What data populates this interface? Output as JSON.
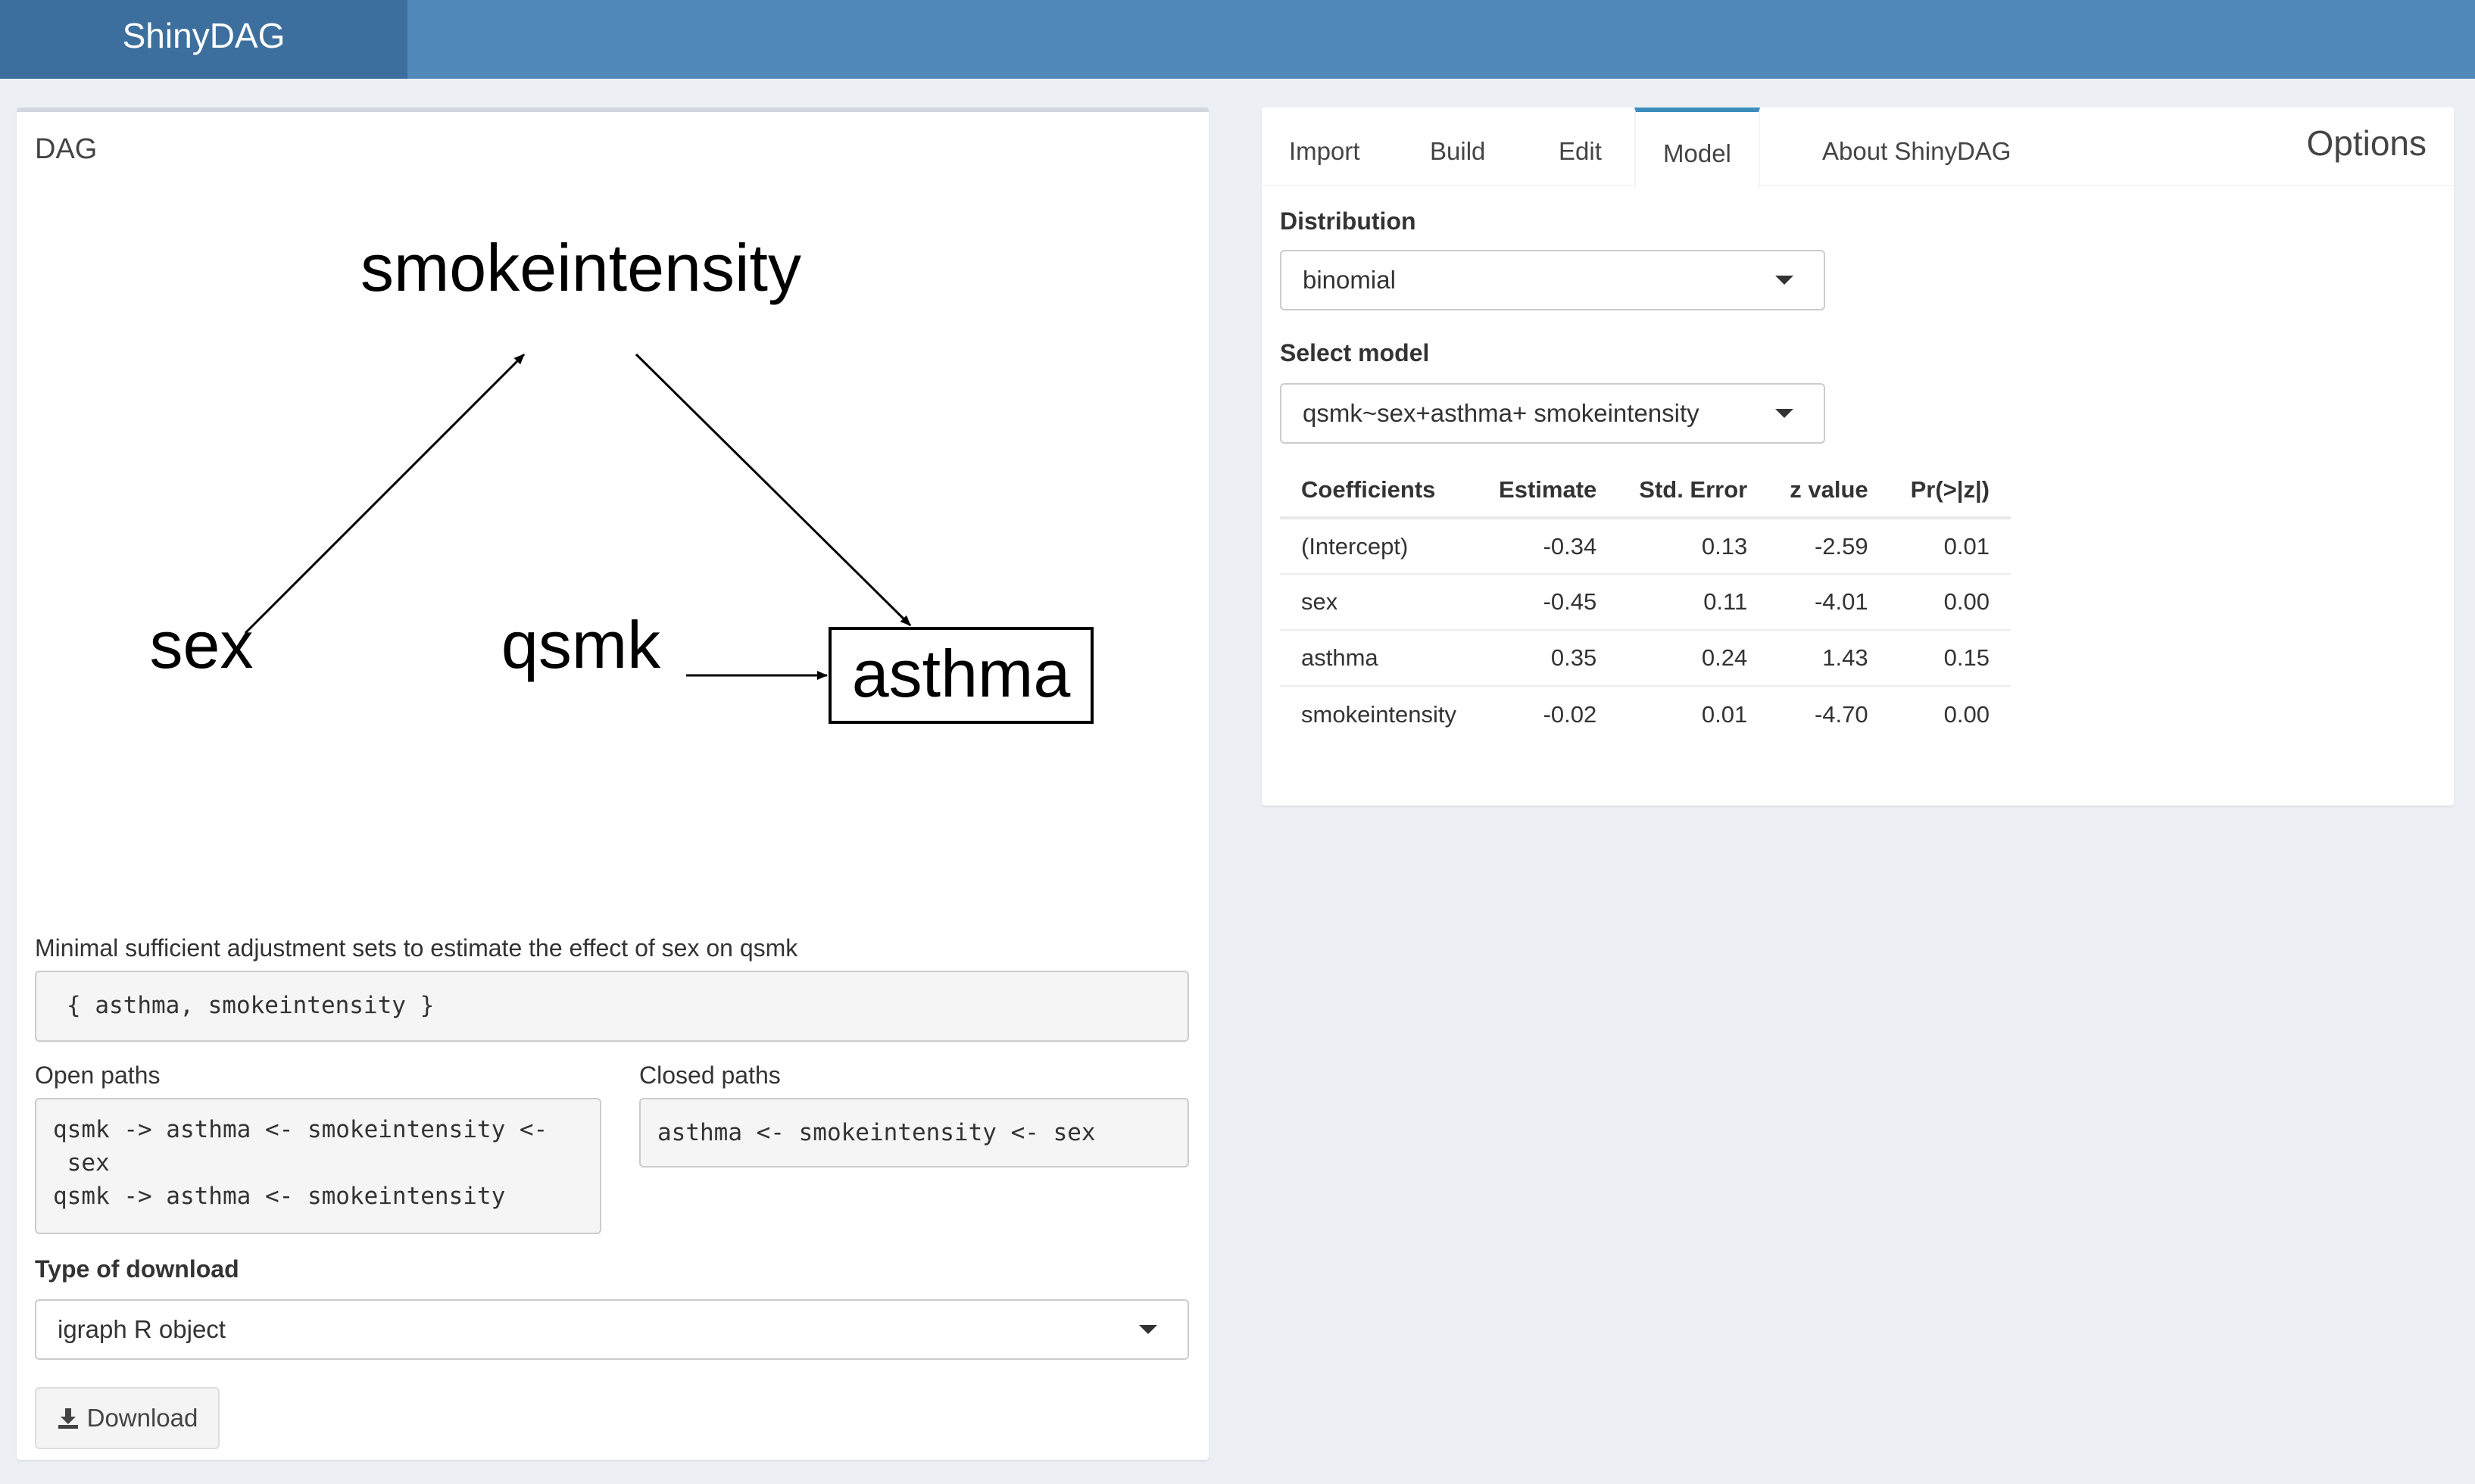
{
  "app": {
    "title": "ShinyDAG"
  },
  "dag_panel": {
    "title": "DAG",
    "nodes": [
      "smokeintensity",
      "sex",
      "qsmk",
      "asthma"
    ],
    "adjustment_label": "Minimal sufficient adjustment sets to estimate the effect of sex on qsmk",
    "adjustment_set": "{ asthma, smokeintensity }",
    "open_paths_label": "Open paths",
    "open_paths": "qsmk -> asthma <- smokeintensity <-\n sex\nqsmk -> asthma <- smokeintensity",
    "closed_paths_label": "Closed paths",
    "closed_paths": "asthma <- smokeintensity <- sex",
    "download_type_label": "Type of download",
    "download_type_value": "igraph R object",
    "download_button": "Download"
  },
  "options_panel": {
    "title": "Options",
    "tabs": [
      "Import",
      "Build",
      "Edit",
      "Model",
      "About ShinyDAG"
    ],
    "active_tab": "Model",
    "distribution_label": "Distribution",
    "distribution_value": "binomial",
    "model_label": "Select model",
    "model_value": "qsmk~sex+asthma+ smokeintensity",
    "table": {
      "headers": [
        "Coefficients",
        "Estimate",
        "Std. Error",
        "z value",
        "Pr(>|z|)"
      ],
      "rows": [
        [
          "(Intercept)",
          "-0.34",
          "0.13",
          "-2.59",
          "0.01"
        ],
        [
          "sex",
          "-0.45",
          "0.11",
          "-4.01",
          "0.00"
        ],
        [
          "asthma",
          "0.35",
          "0.24",
          "1.43",
          "0.15"
        ],
        [
          "smokeintensity",
          "-0.02",
          "0.01",
          "-4.70",
          "0.00"
        ]
      ]
    }
  }
}
